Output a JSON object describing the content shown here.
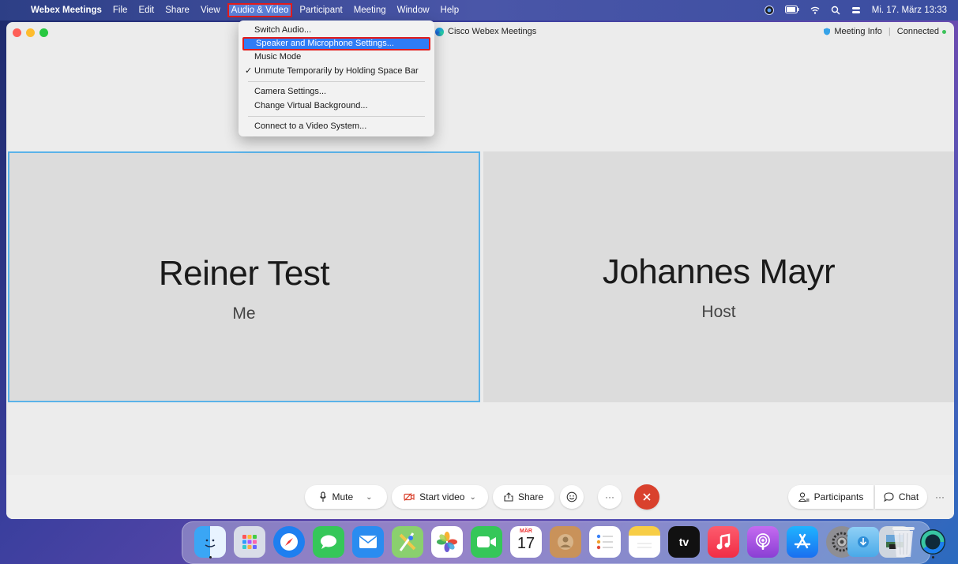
{
  "menubar": {
    "app_name": "Webex Meetings",
    "items": [
      "File",
      "Edit",
      "Share",
      "View",
      "Audio & Video",
      "Participant",
      "Meeting",
      "Window",
      "Help"
    ],
    "active_item": "Audio & Video",
    "datetime": "Mi. 17. März 13:33"
  },
  "window": {
    "title": "Cisco Webex Meetings",
    "meeting_info": "Meeting Info",
    "status": "Connected"
  },
  "menu": {
    "items": {
      "switch_audio": "Switch Audio...",
      "speaker_mic": "Speaker and Microphone Settings...",
      "music_mode": "Music Mode",
      "unmute_temp": "Unmute Temporarily by Holding Space Bar",
      "camera": "Camera Settings...",
      "virtual_bg": "Change Virtual Background...",
      "video_system": "Connect to a Video System..."
    },
    "checkmark": "✓"
  },
  "tiles": {
    "me": {
      "name": "Reiner Test",
      "role": "Me"
    },
    "host": {
      "name": "Johannes Mayr",
      "role": "Host"
    }
  },
  "controls": {
    "mute": "Mute",
    "start_video": "Start video",
    "share": "Share",
    "participants": "Participants",
    "chat": "Chat",
    "more": "···"
  },
  "dock": {
    "calendar_month": "MÄR",
    "calendar_day": "17",
    "tv_label": "tv"
  },
  "colors": {
    "accent": "#2f7cf6",
    "end_call": "#d9412d",
    "highlight_border": "#e21b1b",
    "tile_border": "#5ab2e8"
  }
}
